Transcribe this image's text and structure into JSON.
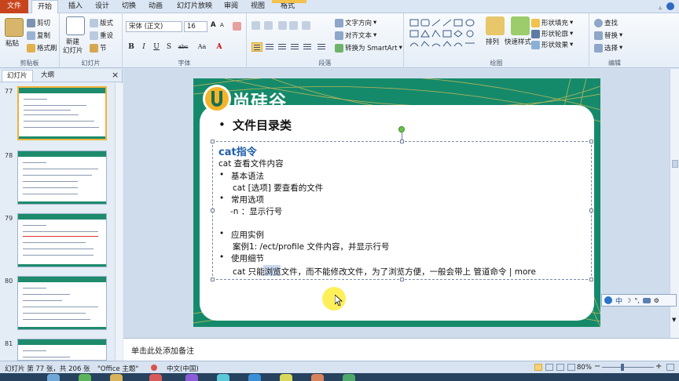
{
  "tabs": [
    "文件",
    "开始",
    "插入",
    "设计",
    "切换",
    "动画",
    "幻灯片放映",
    "审阅",
    "视图",
    "格式"
  ],
  "ribbon": {
    "clipboard": {
      "paste": "粘贴",
      "cut": "剪切",
      "copy": "复制",
      "format_painter": "格式刷",
      "label": "剪贴板"
    },
    "slides": {
      "new_slide": "新建",
      "new_slide2": "幻灯片",
      "layout": "版式",
      "reset": "重设",
      "section": "节",
      "label": "幻灯片"
    },
    "font": {
      "font_name": "宋体 (正文)",
      "font_size": "16",
      "bold": "B",
      "italic": "I",
      "underline": "U",
      "strike": "S",
      "shadow": "abc",
      "label": "字体",
      "font_color": "A",
      "aa": "Aa"
    },
    "paragraph": {
      "text_direction": "文字方向",
      "align_text": "对齐文本",
      "smartart": "转换为 SmartArt",
      "label": "段落"
    },
    "drawing": {
      "arrange": "排列",
      "quick_styles": "快速样式",
      "shape_fill": "形状填充",
      "shape_outline": "形状轮廓",
      "shape_effects": "形状效果",
      "label": "绘图"
    },
    "editing": {
      "find": "查找",
      "replace": "替换",
      "select": "选择",
      "label": "编辑"
    }
  },
  "panel": {
    "tab_slides": "幻灯片",
    "tab_outline": "大纲",
    "close": "×",
    "thumbs": [
      {
        "num": "77"
      },
      {
        "num": "78"
      },
      {
        "num": "79"
      },
      {
        "num": "80"
      },
      {
        "num": "81"
      }
    ]
  },
  "slide": {
    "logo_text": "尚硅谷",
    "title": "文件目录类",
    "heading": "cat指令",
    "lines": [
      "cat 查看文件内容",
      "基本语法",
      "cat  [选项] 要查看的文件",
      "常用选项",
      "-n ：显示行号",
      "应用实例",
      "案例1:  /ect/profile  文件内容，并显示行号",
      "使用细节",
      "cat 只能浏览文件，而不能修改文件，为了浏览方便，一般会带上  管道命令 | more"
    ],
    "bullet": "•"
  },
  "notes": {
    "placeholder": "单击此处添加备注"
  },
  "status": {
    "slide_info": "幻灯片 第 77 张，共 206 张",
    "theme": "\"Office 主题\"",
    "language": "中文(中国)",
    "zoom": "80%"
  },
  "ime": {
    "label": "中"
  },
  "colors": {
    "file_tab": "#c8441d",
    "slide_green": "#158a6a",
    "heading_blue": "#1f5fa8",
    "selected_thumb": "#f0b23b"
  }
}
